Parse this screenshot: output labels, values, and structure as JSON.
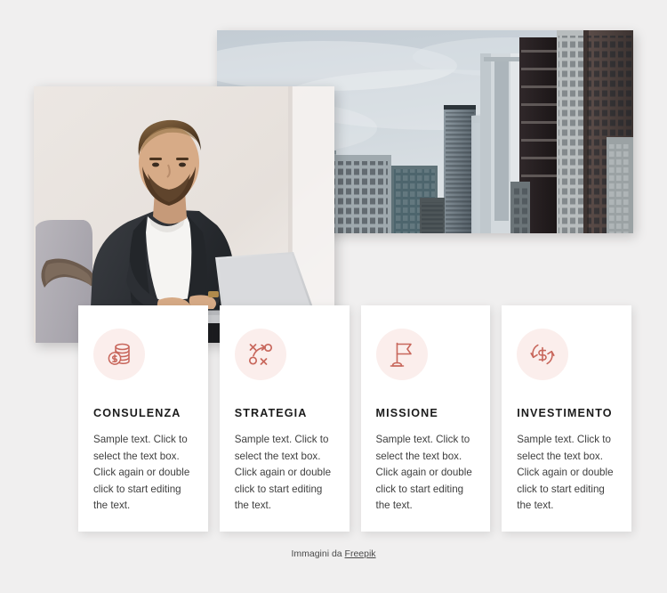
{
  "page": {
    "background_color": "#f0efef",
    "accent_color": "#c8675c",
    "icon_circle_color": "#fbeeec",
    "card_background": "#ffffff",
    "title_color": "#1b1b1b",
    "body_text_color": "#3f3f3f"
  },
  "media": {
    "city_photo": {
      "alt": "Skyscrapers and office towers seen from street level under a cloudy sky",
      "name": "city-skyline-photo"
    },
    "man_photo": {
      "alt": "Bearded businessman in a dark blazer working on a laptop in an armchair",
      "name": "businessman-laptop-photo"
    }
  },
  "cards": [
    {
      "icon": "coins-stack-icon",
      "title": "CONSULENZA",
      "body": "Sample text. Click to select the text box. Click again or double click to start editing the text."
    },
    {
      "icon": "strategy-playbook-icon",
      "title": "STRATEGIA",
      "body": "Sample text. Click to select the text box. Click again or double click to start editing the text."
    },
    {
      "icon": "flag-icon",
      "title": "MISSIONE",
      "body": "Sample text. Click to select the text box. Click again or double click to start editing the text."
    },
    {
      "icon": "dollar-refresh-icon",
      "title": "INVESTIMENTO",
      "body": "Sample text. Click to select the text box. Click again or double click to start editing the text."
    }
  ],
  "credit": {
    "prefix": "Immagini da ",
    "link_label": "Freepik"
  }
}
